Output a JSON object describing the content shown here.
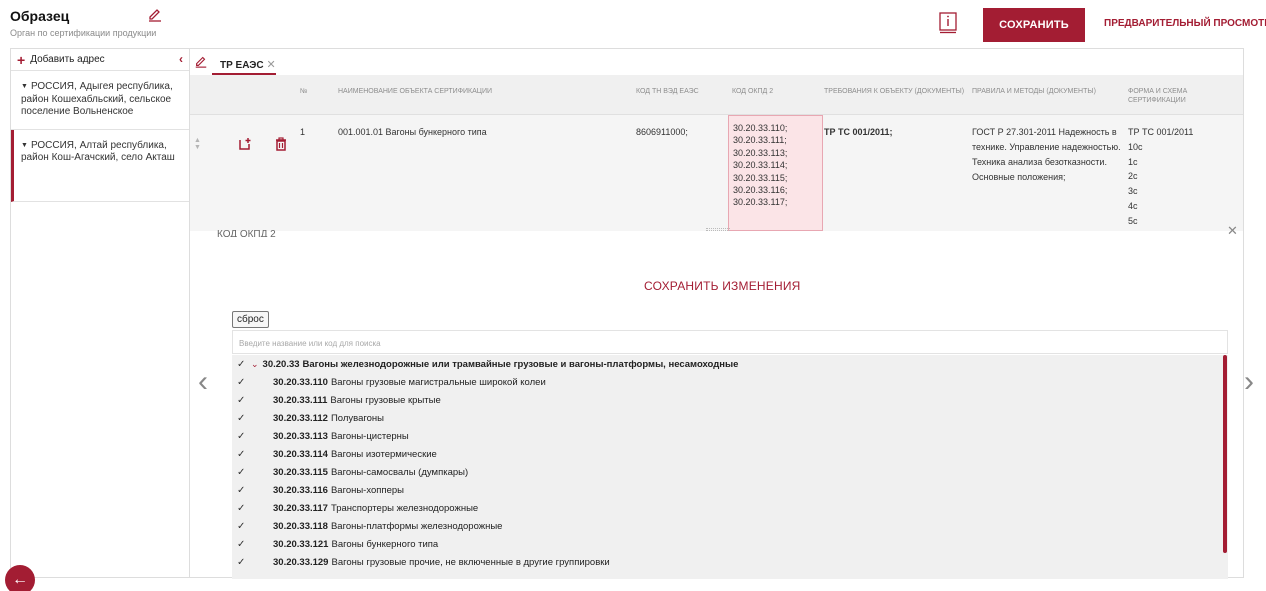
{
  "header": {
    "title": "Образец",
    "subtitle": "Орган по сертификации продукции",
    "save_label": "СОХРАНИТЬ",
    "preview_label": "ПРЕДВАРИТЕЛЬНЫЙ ПРОСМОТР",
    "accent_color": "#a31d33"
  },
  "sidebar": {
    "add_label": "Добавить адрес",
    "addresses": [
      {
        "label": "РОССИЯ, Адыгея республика, район Кошехабльский, сельское поселение Вольненское"
      },
      {
        "label": "РОССИЯ, Алтай республика, район Кош-Агачский, село Акташ"
      }
    ]
  },
  "tabs": [
    {
      "label": "ТР ЕАЭС"
    }
  ],
  "grid": {
    "columns": {
      "num": "№",
      "name": "НАИМЕНОВАНИЕ ОБЪЕКТА СЕРТИФИКАЦИИ",
      "tnved": "КОД ТН ВЭД ЕАЭС",
      "okpd": "КОД ОКПД 2",
      "req": "ТРЕБОВАНИЯ К ОБЪЕКТУ (ДОКУМЕНТЫ)",
      "rules": "ПРАВИЛА И МЕТОДЫ (ДОКУМЕНТЫ)",
      "form": "ФОРМА И СХЕМА СЕРТИФИКАЦИИ"
    },
    "row": {
      "num": "1",
      "name": "001.001.01 Вагоны бункерного типа",
      "tnved": "8606911000;",
      "okpd": [
        "30.20.33.110;",
        "30.20.33.111;",
        "30.20.33.113;",
        "30.20.33.114;",
        "30.20.33.115;",
        "30.20.33.116;",
        "30.20.33.117;"
      ],
      "req": "ТР ТС 001/2011;",
      "rules": "ГОСТ Р 27.301-2011 Надежность в технике. Управление надежностью. Техника анализа безотказности. Основные положения;",
      "form": [
        "ТР ТС 001/2011",
        "10с",
        "1с",
        "2с",
        "3с",
        "4с",
        "5с"
      ]
    }
  },
  "okpd_panel": {
    "label": "КОД ОКПД 2",
    "save_changes_label": "СОХРАНИТЬ ИЗМЕНЕНИЯ",
    "reset_label": "сброс",
    "search_placeholder": "Введите название или код для поиска",
    "root": {
      "code": "30.20.33",
      "name": "Вагоны железнодорожные или трамвайные грузовые и вагоны-платформы, несамоходные"
    },
    "items": [
      {
        "code": "30.20.33.110",
        "name": "Вагоны грузовые магистральные широкой колеи"
      },
      {
        "code": "30.20.33.111",
        "name": "Вагоны грузовые крытые"
      },
      {
        "code": "30.20.33.112",
        "name": "Полувагоны"
      },
      {
        "code": "30.20.33.113",
        "name": "Вагоны-цистерны"
      },
      {
        "code": "30.20.33.114",
        "name": "Вагоны изотермические"
      },
      {
        "code": "30.20.33.115",
        "name": "Вагоны-самосвалы (думпкары)"
      },
      {
        "code": "30.20.33.116",
        "name": "Вагоны-хопперы"
      },
      {
        "code": "30.20.33.117",
        "name": "Транспортеры железнодорожные"
      },
      {
        "code": "30.20.33.118",
        "name": "Вагоны-платформы железнодорожные"
      },
      {
        "code": "30.20.33.121",
        "name": "Вагоны бункерного типа"
      },
      {
        "code": "30.20.33.129",
        "name": "Вагоны грузовые прочие, не включенные в другие группировки"
      }
    ]
  },
  "icons": {
    "info": "info-book-icon",
    "edit": "pencil-icon",
    "copy": "copy-icon",
    "delete": "trash-icon",
    "back": "arrow-left-icon"
  }
}
